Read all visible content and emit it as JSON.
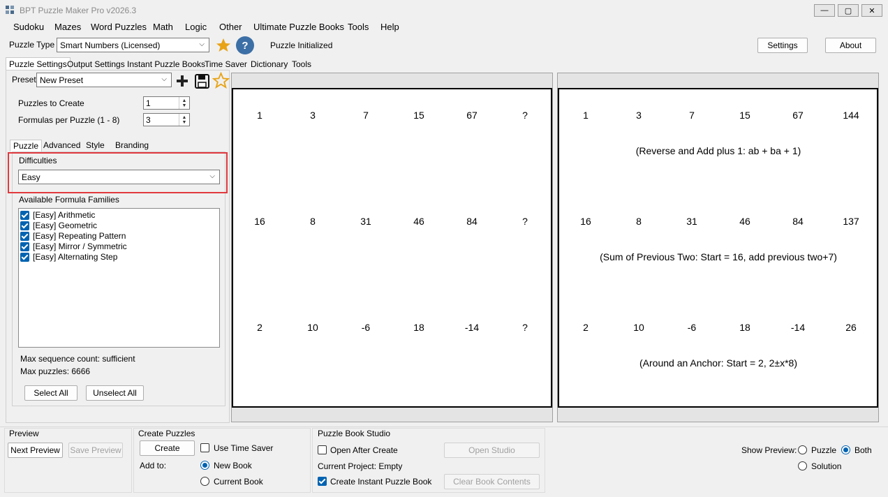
{
  "app": {
    "title": "BPT Puzzle Maker Pro v2026.3",
    "window_buttons": {
      "minimize": "—",
      "maximize": "▢",
      "close": "✕"
    }
  },
  "menu": [
    "Sudoku",
    "Mazes",
    "Word Puzzles",
    "Math",
    "Logic",
    "Other",
    "Ultimate Puzzle Books",
    "Tools",
    "Help"
  ],
  "toolbar": {
    "puzzle_type_label": "Puzzle Type",
    "puzzle_type_value": "Smart Numbers (Licensed)",
    "help_symbol": "?",
    "status": "Puzzle Initialized",
    "settings_label": "Settings",
    "about_label": "About",
    "star_color": "#e8a317",
    "help_color": "#3c6fa5"
  },
  "tabs": [
    "Puzzle Settings",
    "Output Settings",
    "Instant Puzzle Books",
    "Time Saver",
    "Dictionary",
    "Tools"
  ],
  "left": {
    "preset_label": "Preset",
    "preset_value": "New Preset",
    "puzzles_to_create_label": "Puzzles to Create",
    "puzzles_to_create_value": "1",
    "formulas_label": "Formulas per Puzzle (1 - 8)",
    "formulas_value": "3",
    "subtabs": [
      "Puzzle",
      "Advanced",
      "Style",
      "Branding"
    ],
    "difficulties_label": "Difficulties",
    "difficulty_value": "Easy",
    "families_label": "Available Formula Families",
    "families": [
      "[Easy] Arithmetic",
      "[Easy] Geometric",
      "[Easy] Repeating Pattern",
      "[Easy] Mirror / Symmetric",
      "[Easy] Alternating Step"
    ],
    "max_sequence": "Max sequence count: sufficient",
    "max_puzzles": "Max puzzles: 6666",
    "select_all": "Select All",
    "unselect_all": "Unselect All",
    "highlight_color": "#e0393e"
  },
  "puzzle_preview": {
    "rows": [
      [
        "1",
        "3",
        "7",
        "15",
        "67",
        "?"
      ],
      [
        "16",
        "8",
        "31",
        "46",
        "84",
        "?"
      ],
      [
        "2",
        "10",
        "-6",
        "18",
        "-14",
        "?"
      ]
    ]
  },
  "solution_preview": {
    "rows": [
      [
        "1",
        "3",
        "7",
        "15",
        "67",
        "144"
      ],
      [
        "16",
        "8",
        "31",
        "46",
        "84",
        "137"
      ],
      [
        "2",
        "10",
        "-6",
        "18",
        "-14",
        "26"
      ]
    ],
    "explanations": [
      "(Reverse and Add plus 1: ab + ba + 1)",
      "(Sum of Previous Two: Start = 16, add previous two+7)",
      "(Around an Anchor: Start = 2, 2±x*8)"
    ]
  },
  "bottom": {
    "preview_title": "Preview",
    "next_preview": "Next Preview",
    "save_preview": "Save Preview",
    "create_title": "Create Puzzles",
    "create_label": "Create",
    "use_time_saver": "Use Time Saver",
    "add_to": "Add to:",
    "new_book": "New Book",
    "current_book": "Current Book",
    "studio_title": "Puzzle Book Studio",
    "open_after_create": "Open After Create",
    "open_studio": "Open Studio",
    "current_project": "Current Project: Empty",
    "create_instant": "Create Instant Puzzle Book",
    "clear_book": "Clear Book Contents",
    "show_preview": "Show Preview:",
    "opt_puzzle": "Puzzle",
    "opt_both": "Both",
    "opt_solution": "Solution"
  }
}
